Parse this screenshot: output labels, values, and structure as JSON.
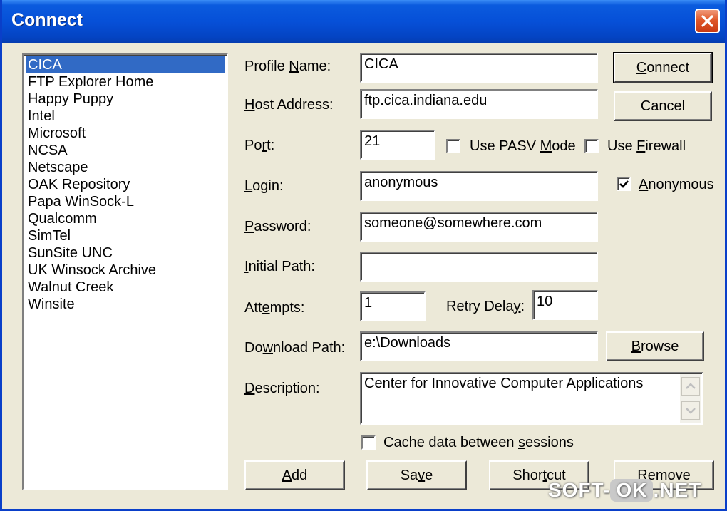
{
  "window": {
    "title": "Connect"
  },
  "profiles": {
    "items": [
      "CICA",
      "FTP Explorer Home",
      "Happy Puppy",
      "Intel",
      "Microsoft",
      "NCSA",
      "Netscape",
      "OAK Repository",
      "Papa WinSock-L",
      "Qualcomm",
      "SimTel",
      "SunSite UNC",
      "UK Winsock Archive",
      "Walnut Creek",
      "Winsite"
    ],
    "selected": "CICA"
  },
  "labels": {
    "profile_name": [
      "Profile ",
      "N",
      "ame:"
    ],
    "host_address": [
      "",
      "H",
      "ost Address:"
    ],
    "port": [
      "Po",
      "r",
      "t:"
    ],
    "login": [
      "",
      "L",
      "ogin:"
    ],
    "password": [
      "",
      "P",
      "assword:"
    ],
    "initial_path": [
      "",
      "I",
      "nitial Path:"
    ],
    "attempts": [
      "Att",
      "e",
      "mpts:"
    ],
    "retry_delay": [
      "Retry Dela",
      "y",
      ":"
    ],
    "download_path": [
      "Do",
      "w",
      "nload Path:"
    ],
    "description": [
      "",
      "D",
      "escription:"
    ],
    "use_pasv": [
      "Use PASV ",
      "M",
      "ode"
    ],
    "use_firewall": [
      "Use ",
      "F",
      "irewall"
    ],
    "anonymous": [
      "",
      "A",
      "nonymous"
    ],
    "cache": [
      "Cache data between ",
      "s",
      "essions"
    ]
  },
  "fields": {
    "profile_name": "CICA",
    "host_address": "ftp.cica.indiana.edu",
    "port": "21",
    "login": "anonymous",
    "password": "someone@somewhere.com",
    "initial_path": "",
    "attempts": "1",
    "retry_delay": "10",
    "download_path": "e:\\Downloads",
    "description": "Center for Innovative Computer Applications"
  },
  "checkboxes": {
    "use_pasv": false,
    "use_firewall": false,
    "anonymous": true,
    "cache": false
  },
  "buttons": {
    "connect": [
      "",
      "C",
      "onnect"
    ],
    "cancel": [
      "Cancel"
    ],
    "browse": [
      "",
      "B",
      "rowse"
    ],
    "add": [
      "",
      "A",
      "dd"
    ],
    "save": [
      "Sa",
      "v",
      "e"
    ],
    "shortcut": [
      "Shor",
      "t",
      "cut"
    ],
    "remove": [
      "",
      "R",
      "emove"
    ]
  },
  "watermark": {
    "left": "SOFT-",
    "ok": "OK",
    "right": ".NET"
  },
  "colors": {
    "titlebar": "#0650d8",
    "selection": "#316ac5",
    "face": "#ece9d8"
  }
}
